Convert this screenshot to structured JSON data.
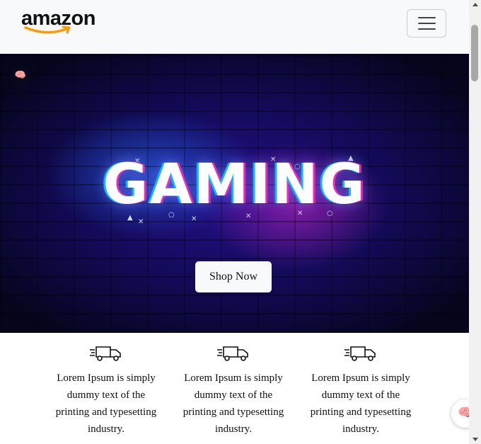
{
  "navbar": {
    "brand": "amazon",
    "toggler_label": "Toggle navigation"
  },
  "hero": {
    "title": "GAMING",
    "badge_icon": "brain-icon",
    "button_label": "Shop Now"
  },
  "features": [
    {
      "icon": "delivery-truck-icon",
      "text": "Lorem Ipsum is simply dummy text of the printing and typesetting industry."
    },
    {
      "icon": "delivery-truck-icon",
      "text": "Lorem Ipsum is simply dummy text of the printing and typesetting industry."
    },
    {
      "icon": "delivery-truck-icon",
      "text": "Lorem Ipsum is simply dummy text of the printing and typesetting industry."
    }
  ],
  "floating_button": {
    "icon": "brain-icon"
  },
  "colors": {
    "navbar_bg": "#f8f9fa",
    "logo_smile": "#ff9900",
    "hero_dark": "#0a0a3a",
    "glow_blue": "#2878ff",
    "glow_pink": "#d228c8"
  }
}
